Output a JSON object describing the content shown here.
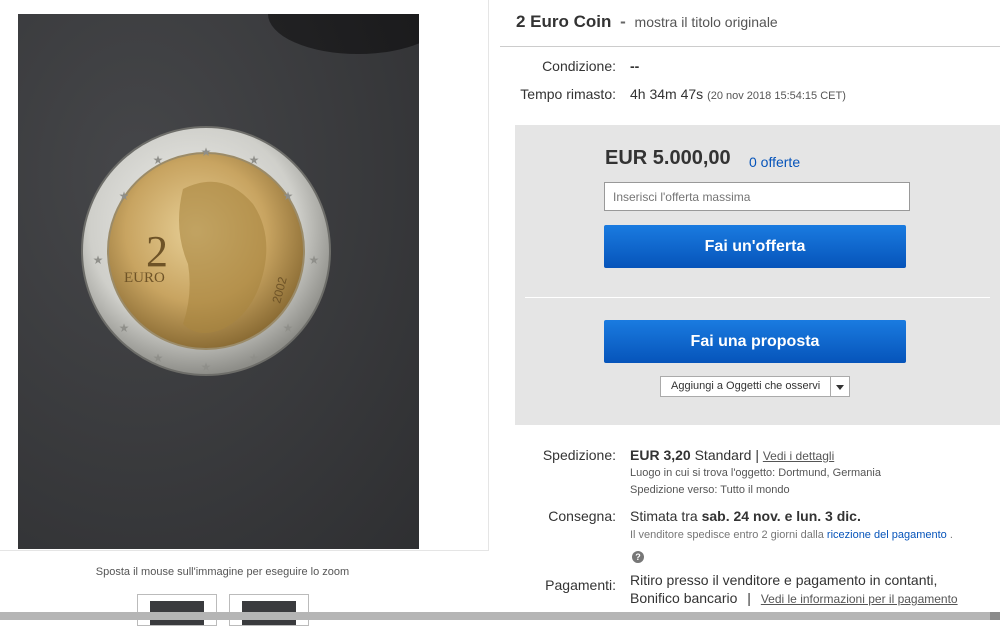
{
  "listing": {
    "title": "2 Euro Coin",
    "separator": "-",
    "original_title_link": "mostra il titolo originale"
  },
  "image": {
    "zoom_hint": "Sposta il mouse sull'immagine per eseguire lo zoom",
    "coin_value": "2",
    "coin_currency": "EURO",
    "coin_year": "2002"
  },
  "details": {
    "condition_label": "Condizione:",
    "condition_value": "--",
    "time_label": "Tempo rimasto:",
    "time_value": "4h 34m 47s",
    "time_end": "(20 nov 2018   15:54:15 CET)"
  },
  "bid": {
    "price": "EUR 5.000,00",
    "offers": "0 offerte",
    "input_placeholder": "Inserisci l'offerta massima",
    "bid_button": "Fai un'offerta",
    "offer_button": "Fai una proposta",
    "watch_button": "Aggiungi a Oggetti che osservi"
  },
  "shipping": {
    "label": "Spedizione:",
    "price": "EUR 3,20",
    "method": "Standard",
    "separator": "|",
    "details_link": "Vedi i dettagli",
    "location": "Luogo in cui si trova l'oggetto:  Dortmund, Germania",
    "ships_to": "Spedizione verso:  Tutto il mondo"
  },
  "delivery": {
    "label": "Consegna:",
    "estimate_prefix": "Stimata tra",
    "estimate_dates": "sab. 24 nov. e lun. 3 dic.",
    "dispatch_note": "Il venditore spedisce entro 2 giorni dalla",
    "payment_link": "ricezione del pagamento",
    "help_icon": "?"
  },
  "payments": {
    "label": "Pagamenti:",
    "line1": "Ritiro presso il venditore e pagamento in contanti,",
    "line2": "Bonifico bancario",
    "separator": "|",
    "info_link": "Vedi le informazioni per il pagamento"
  },
  "colors": {
    "link": "#0654ba",
    "button": "#0654ba",
    "panel": "#e5e5e5"
  }
}
